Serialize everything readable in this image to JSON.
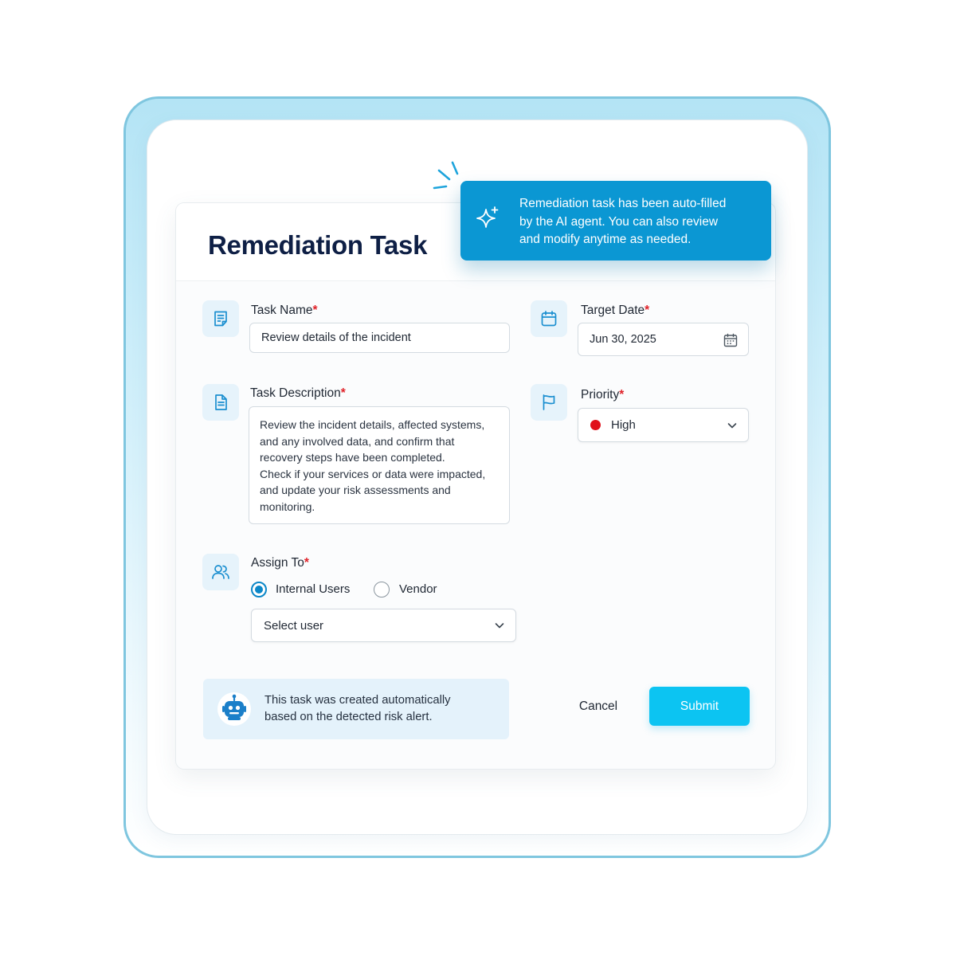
{
  "page": {
    "title": "Remediation Task"
  },
  "ai_banner": {
    "line1": "Remediation task has been auto-filled",
    "line2": "by the AI agent. You can also review",
    "line3": "and modify anytime as needed.",
    "icon": "sparkle-icon"
  },
  "fields": {
    "task_name": {
      "label": "Task Name",
      "required": "*",
      "value": "Review details of the incident"
    },
    "target_date": {
      "label": "Target Date",
      "required": "*",
      "value": "Jun 30, 2025"
    },
    "task_description": {
      "label": "Task Description",
      "required": "*",
      "lines": [
        "Review the incident details, affected systems,",
        "and any involved data, and confirm that",
        "recovery steps have been completed.",
        "Check if your services or data were impacted,",
        "and update your risk assessments and",
        "monitoring."
      ]
    },
    "priority": {
      "label": "Priority",
      "required": "*",
      "value": "High",
      "color": "#e0111b"
    },
    "assign_to": {
      "label": "Assign To",
      "required": "*",
      "options": [
        "Internal Users",
        "Vendor"
      ],
      "selected": "Internal Users",
      "user_select": "Select user"
    }
  },
  "auto_note": {
    "line1": "This task was created automatically",
    "line2": "based on the detected risk alert.",
    "icon": "robot-icon"
  },
  "actions": {
    "cancel": "Cancel",
    "submit": "Submit"
  },
  "colors": {
    "accent": "#0b97d3",
    "submit": "#0cc4f2",
    "title": "#0e1f45",
    "required": "#e0242b"
  }
}
